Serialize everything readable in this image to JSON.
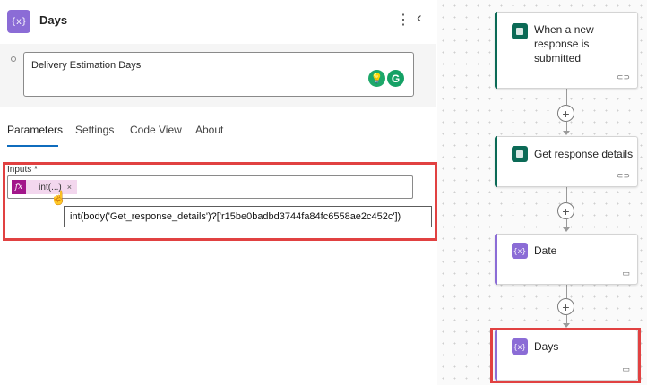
{
  "panel": {
    "icon_glyph": "{x}",
    "title": "Days",
    "more_glyph": "⋮",
    "collapse_glyph": "‹",
    "description": "Delivery Estimation Days",
    "description_icons": [
      "lightbulb-icon",
      "grammarly-icon"
    ],
    "grammarly_glyph": "G",
    "bulb_glyph": "💡",
    "tabs": [
      {
        "label": "Parameters",
        "active": true
      },
      {
        "label": "Settings",
        "active": false
      },
      {
        "label": "Code View",
        "active": false
      },
      {
        "label": "About",
        "active": false
      }
    ],
    "inputs_label": "Inputs *",
    "fx_glyph": "fx",
    "token_text": "int(...)",
    "token_close": "×",
    "tooltip": "int(body('Get_response_details')?['r15be0badbd3744fa84fc6558ae2c452c'])"
  },
  "canvas": {
    "cards": [
      {
        "title_lines": [
          "When a new",
          "response is",
          "submitted"
        ],
        "icon": "forms-icon",
        "footer_icon": "link-icon",
        "accent": "#0b6a56"
      },
      {
        "title_lines": [
          "Get response details"
        ],
        "icon": "forms-icon",
        "footer_icon": "link-icon",
        "accent": "#0b6a56"
      },
      {
        "title_lines": [
          "Date"
        ],
        "icon": "variable-icon",
        "footer_icon": "comment-icon",
        "accent": "#8b6cd6"
      },
      {
        "title_lines": [
          "Days"
        ],
        "icon": "variable-icon",
        "footer_icon": "comment-icon",
        "accent": "#8b6cd6"
      }
    ],
    "add_glyph": "+",
    "link_glyph": "⊂⊃",
    "comment_glyph": "▭"
  },
  "colors": {
    "highlight": "#e14141",
    "tab_underline": "#0f6cbd",
    "fx_badge": "#a2168a",
    "token_bg": "#f3d7ee"
  }
}
